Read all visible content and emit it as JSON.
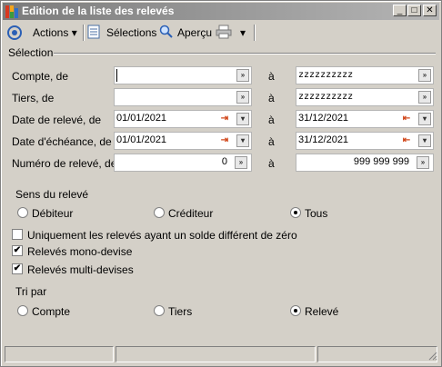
{
  "window": {
    "title": "Edition de la liste des relevés",
    "buttons": {
      "minimize": "_",
      "maximize": "□",
      "close": "✕"
    }
  },
  "toolbar": {
    "actions_label": "Actions",
    "selections_label": "Sélections",
    "apercu_label": "Aperçu",
    "dropdown_arrow": "▾"
  },
  "selection": {
    "group_label": "Sélection",
    "a_label": "à",
    "compte": {
      "label": "Compte, de",
      "from": "",
      "to": "zzzzzzzzzz"
    },
    "tiers": {
      "label": "Tiers, de",
      "from": "",
      "to": "zzzzzzzzzz"
    },
    "date_releve": {
      "label": "Date de relevé, de",
      "from": "01/01/2021",
      "to": "31/12/2021"
    },
    "date_echeance": {
      "label": "Date d'échéance, de",
      "from": "01/01/2021",
      "to": "31/12/2021"
    },
    "numero": {
      "label": "Numéro de relevé, de",
      "from": "0",
      "to": "999 999 999"
    }
  },
  "sens": {
    "label": "Sens du relevé",
    "options": [
      "Débiteur",
      "Créditeur",
      "Tous"
    ],
    "selected": "Tous"
  },
  "checks": {
    "solde_non_zero": {
      "label": "Uniquement les relevés ayant un solde différent de zéro",
      "checked": false
    },
    "mono_devise": {
      "label": "Relevés mono-devise",
      "checked": true
    },
    "multi_devises": {
      "label": "Relevés multi-devises",
      "checked": true
    }
  },
  "tri": {
    "label": "Tri par",
    "options": [
      "Compte",
      "Tiers",
      "Relevé"
    ],
    "selected": "Relevé"
  },
  "icons": {
    "dropdown": "»",
    "calendar": "⇥",
    "check": "✔"
  }
}
